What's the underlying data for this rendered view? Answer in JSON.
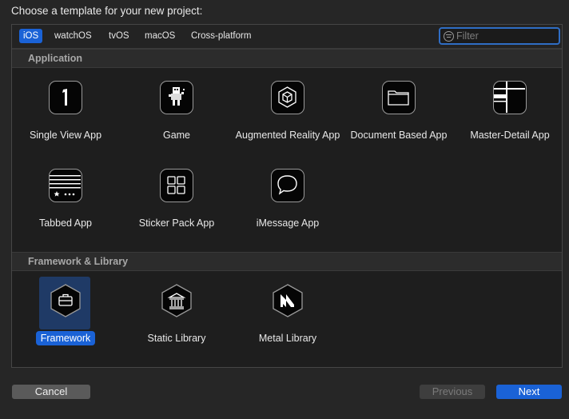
{
  "dialog": {
    "title": "Choose a template for your new project:"
  },
  "platform_tabs": [
    "iOS",
    "watchOS",
    "tvOS",
    "macOS",
    "Cross-platform"
  ],
  "selected_tab": "iOS",
  "filter": {
    "placeholder": "Filter",
    "value": ""
  },
  "sections": {
    "application": {
      "header": "Application",
      "items": [
        {
          "label": "Single View App",
          "icon": "single-view-app-icon"
        },
        {
          "label": "Game",
          "icon": "game-icon"
        },
        {
          "label": "Augmented Reality App",
          "icon": "augmented-reality-icon"
        },
        {
          "label": "Document Based App",
          "icon": "document-icon"
        },
        {
          "label": "Master-Detail App",
          "icon": "master-detail-icon"
        },
        {
          "label": "Tabbed App",
          "icon": "tabbed-app-icon"
        },
        {
          "label": "Sticker Pack App",
          "icon": "sticker-pack-icon"
        },
        {
          "label": "iMessage App",
          "icon": "imessage-icon"
        }
      ]
    },
    "framework": {
      "header": "Framework & Library",
      "items": [
        {
          "label": "Framework",
          "icon": "framework-icon",
          "selected": true
        },
        {
          "label": "Static Library",
          "icon": "static-library-icon"
        },
        {
          "label": "Metal Library",
          "icon": "metal-library-icon"
        }
      ]
    }
  },
  "buttons": {
    "cancel": "Cancel",
    "previous": "Previous",
    "next": "Next"
  },
  "colors": {
    "accent": "#1a62d6",
    "background": "#262626",
    "panel": "#1e1e1e"
  }
}
